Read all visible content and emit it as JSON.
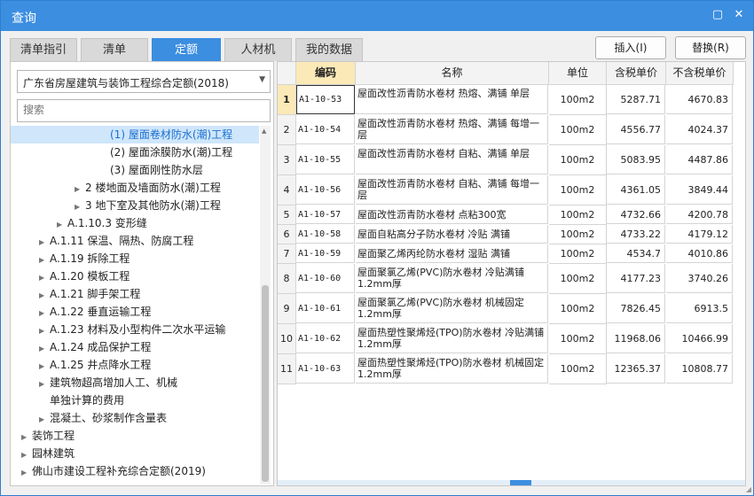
{
  "window": {
    "title": "查询",
    "restore_symbol": "▢",
    "close_symbol": "✕"
  },
  "tabs": [
    {
      "label": "清单指引"
    },
    {
      "label": "清单"
    },
    {
      "label": "定额",
      "active": true
    },
    {
      "label": "人材机"
    },
    {
      "label": "我的数据"
    }
  ],
  "actions": {
    "insert_label": "插入(I)",
    "replace_label": "替换(R)"
  },
  "library_select": {
    "value": "广东省房屋建筑与装饰工程综合定额(2018)"
  },
  "search": {
    "placeholder": "搜索"
  },
  "tree": [
    {
      "label": "(1) 屋面卷材防水(潮)工程",
      "selected": true,
      "expander": ""
    },
    {
      "label": "(2) 屋面涂膜防水(潮)工程",
      "expander": ""
    },
    {
      "label": "(3) 屋面刚性防水层",
      "expander": ""
    },
    {
      "label": "2 楼地面及墙面防水(潮)工程",
      "expander": "▶"
    },
    {
      "label": "3 地下室及其他防水(潮)工程",
      "expander": "▶"
    },
    {
      "label": "A.1.10.3 变形缝",
      "expander": "▶"
    },
    {
      "label": "A.1.11 保温、隔热、防腐工程",
      "expander": "▶"
    },
    {
      "label": "A.1.19 拆除工程",
      "expander": "▶"
    },
    {
      "label": "A.1.20 模板工程",
      "expander": "▶"
    },
    {
      "label": "A.1.21 脚手架工程",
      "expander": "▶"
    },
    {
      "label": "A.1.22 垂直运输工程",
      "expander": "▶"
    },
    {
      "label": "A.1.23 材料及小型构件二次水平运输",
      "expander": "▶"
    },
    {
      "label": "A.1.24 成品保护工程",
      "expander": "▶"
    },
    {
      "label": "A.1.25 井点降水工程",
      "expander": "▶"
    },
    {
      "label": "建筑物超高增加人工、机械",
      "expander": "▶"
    },
    {
      "label": "单独计算的费用",
      "expander": ""
    },
    {
      "label": "混凝土、砂浆制作含量表",
      "expander": "▶"
    },
    {
      "label": "装饰工程",
      "expander": "▶"
    },
    {
      "label": "园林建筑",
      "expander": "▶"
    },
    {
      "label": "佛山市建设工程补充综合定额(2019)",
      "expander": "▶"
    }
  ],
  "table": {
    "headers": {
      "code": "编码",
      "name": "名称",
      "unit": "单位",
      "price_tax": "含税单价",
      "price_notax": "不含税单价"
    },
    "rows": [
      {
        "no": "1",
        "code": "A1-10-53",
        "name": "屋面改性沥青防水卷材 热熔、满铺 单层",
        "unit": "100m2",
        "price_tax": "5287.71",
        "price_notax": "4670.83"
      },
      {
        "no": "2",
        "code": "A1-10-54",
        "name": "屋面改性沥青防水卷材 热熔、满铺 每增一层",
        "unit": "100m2",
        "price_tax": "4556.77",
        "price_notax": "4024.37"
      },
      {
        "no": "3",
        "code": "A1-10-55",
        "name": "屋面改性沥青防水卷材 自粘、满铺 单层",
        "unit": "100m2",
        "price_tax": "5083.95",
        "price_notax": "4487.86"
      },
      {
        "no": "4",
        "code": "A1-10-56",
        "name": "屋面改性沥青防水卷材 自粘、满铺 每增一层",
        "unit": "100m2",
        "price_tax": "4361.05",
        "price_notax": "3849.44"
      },
      {
        "no": "5",
        "code": "A1-10-57",
        "name": "屋面改性沥青防水卷材 点粘300宽",
        "unit": "100m2",
        "price_tax": "4732.66",
        "price_notax": "4200.78"
      },
      {
        "no": "6",
        "code": "A1-10-58",
        "name": "屋面自粘高分子防水卷材 冷贴 满铺",
        "unit": "100m2",
        "price_tax": "4733.22",
        "price_notax": "4179.12"
      },
      {
        "no": "7",
        "code": "A1-10-59",
        "name": "屋面聚乙烯丙纶防水卷材 湿贴 满铺",
        "unit": "100m2",
        "price_tax": "4534.7",
        "price_notax": "4010.86"
      },
      {
        "no": "8",
        "code": "A1-10-60",
        "name": "屋面聚氯乙烯(PVC)防水卷材 冷贴满铺 1.2mm厚",
        "unit": "100m2",
        "price_tax": "4177.23",
        "price_notax": "3740.26"
      },
      {
        "no": "9",
        "code": "A1-10-61",
        "name": "屋面聚氯乙烯(PVC)防水卷材 机械固定 1.2mm厚",
        "unit": "100m2",
        "price_tax": "7826.45",
        "price_notax": "6913.5"
      },
      {
        "no": "10",
        "code": "A1-10-62",
        "name": "屋面热塑性聚烯烃(TPO)防水卷材 冷贴满铺 1.2mm厚",
        "unit": "100m2",
        "price_tax": "11968.06",
        "price_notax": "10466.99"
      },
      {
        "no": "11",
        "code": "A1-10-63",
        "name": "屋面热塑性聚烯烃(TPO)防水卷材 机械固定 1.2mm厚",
        "unit": "100m2",
        "price_tax": "12365.37",
        "price_notax": "10808.77"
      }
    ]
  },
  "colors": {
    "accent": "#3c8ee0",
    "selected_header": "#fbe9b7",
    "tree_selection": "#cfe6fb"
  }
}
